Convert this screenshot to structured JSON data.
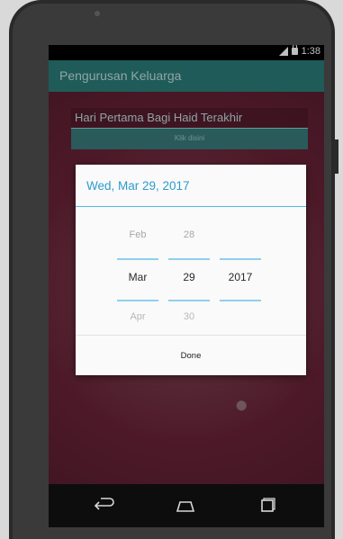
{
  "status_bar": {
    "time": "1:38",
    "signal_icon": "signal-icon",
    "lock_icon": "lock-icon"
  },
  "app": {
    "title": "Pengurusan Keluarga"
  },
  "form": {
    "field_label": "Hari Pertama Bagi Haid Terakhir",
    "button_label": "Klik disini"
  },
  "date_dialog": {
    "header": "Wed, Mar 29, 2017",
    "month": {
      "prev": "Feb",
      "current": "Mar",
      "next": "Apr"
    },
    "day": {
      "prev": "28",
      "current": "29",
      "next": "30"
    },
    "year": {
      "current": "2017"
    },
    "done_label": "Done",
    "accent_color": "#2e9ccb"
  },
  "nav_bar": {
    "back_icon": "back-icon",
    "home_icon": "home-icon",
    "recent_icon": "recent-apps-icon"
  }
}
